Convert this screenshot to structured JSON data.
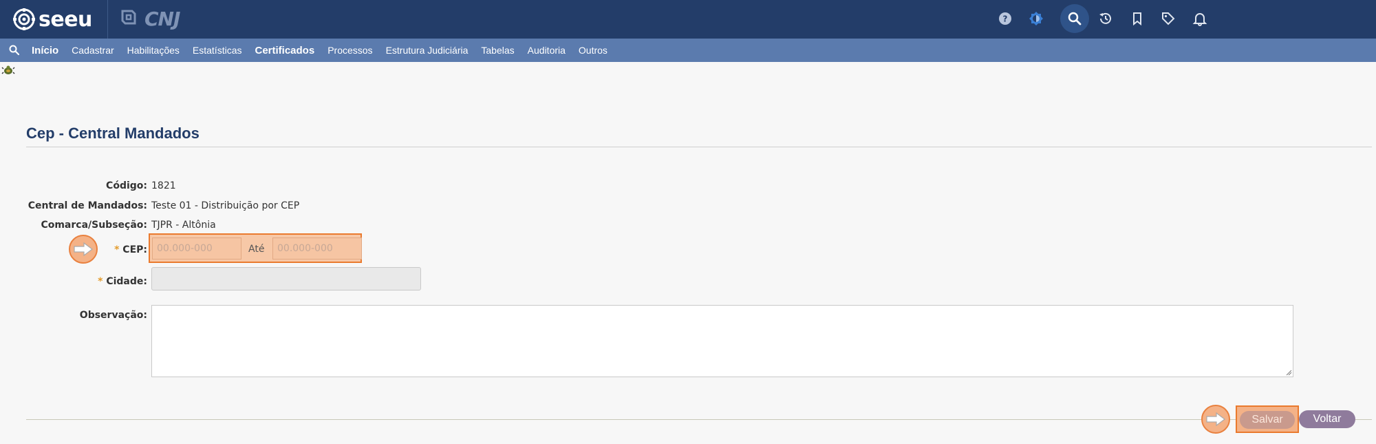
{
  "header": {
    "logo_text": "seeu",
    "cnj_text": "CNJ",
    "icons": [
      "help-icon",
      "theme-icon",
      "search-icon",
      "history-icon",
      "bookmark-icon",
      "tag-icon",
      "bell-icon"
    ]
  },
  "menu": {
    "items": [
      {
        "label": "Início",
        "bold": true
      },
      {
        "label": "Cadastrar",
        "bold": false
      },
      {
        "label": "Habilitações",
        "bold": false
      },
      {
        "label": "Estatísticas",
        "bold": false
      },
      {
        "label": "Certificados",
        "bold": true
      },
      {
        "label": "Processos",
        "bold": false
      },
      {
        "label": "Estrutura Judiciária",
        "bold": false
      },
      {
        "label": "Tabelas",
        "bold": false
      },
      {
        "label": "Auditoria",
        "bold": false
      },
      {
        "label": "Outros",
        "bold": false
      }
    ]
  },
  "page": {
    "title": "Cep - Central Mandados"
  },
  "form": {
    "codigo_label": "Código:",
    "codigo_value": "1821",
    "central_label": "Central de Mandados:",
    "central_value": "Teste 01 - Distribuição por CEP",
    "comarca_label": "Comarca/Subseção:",
    "comarca_value": "TJPR - Altônia",
    "required_mark": "*",
    "cep_label": "CEP:",
    "cep_from_placeholder": "00.000-000",
    "cep_between": "Até",
    "cep_to_placeholder": "00.000-000",
    "cidade_label": "Cidade:",
    "obs_label": "Observação:"
  },
  "actions": {
    "save_label": "Salvar",
    "back_label": "Voltar"
  },
  "colors": {
    "header_bg": "#233d69",
    "menu_bg": "#5b7bae",
    "highlight": "#ea7a2e"
  }
}
